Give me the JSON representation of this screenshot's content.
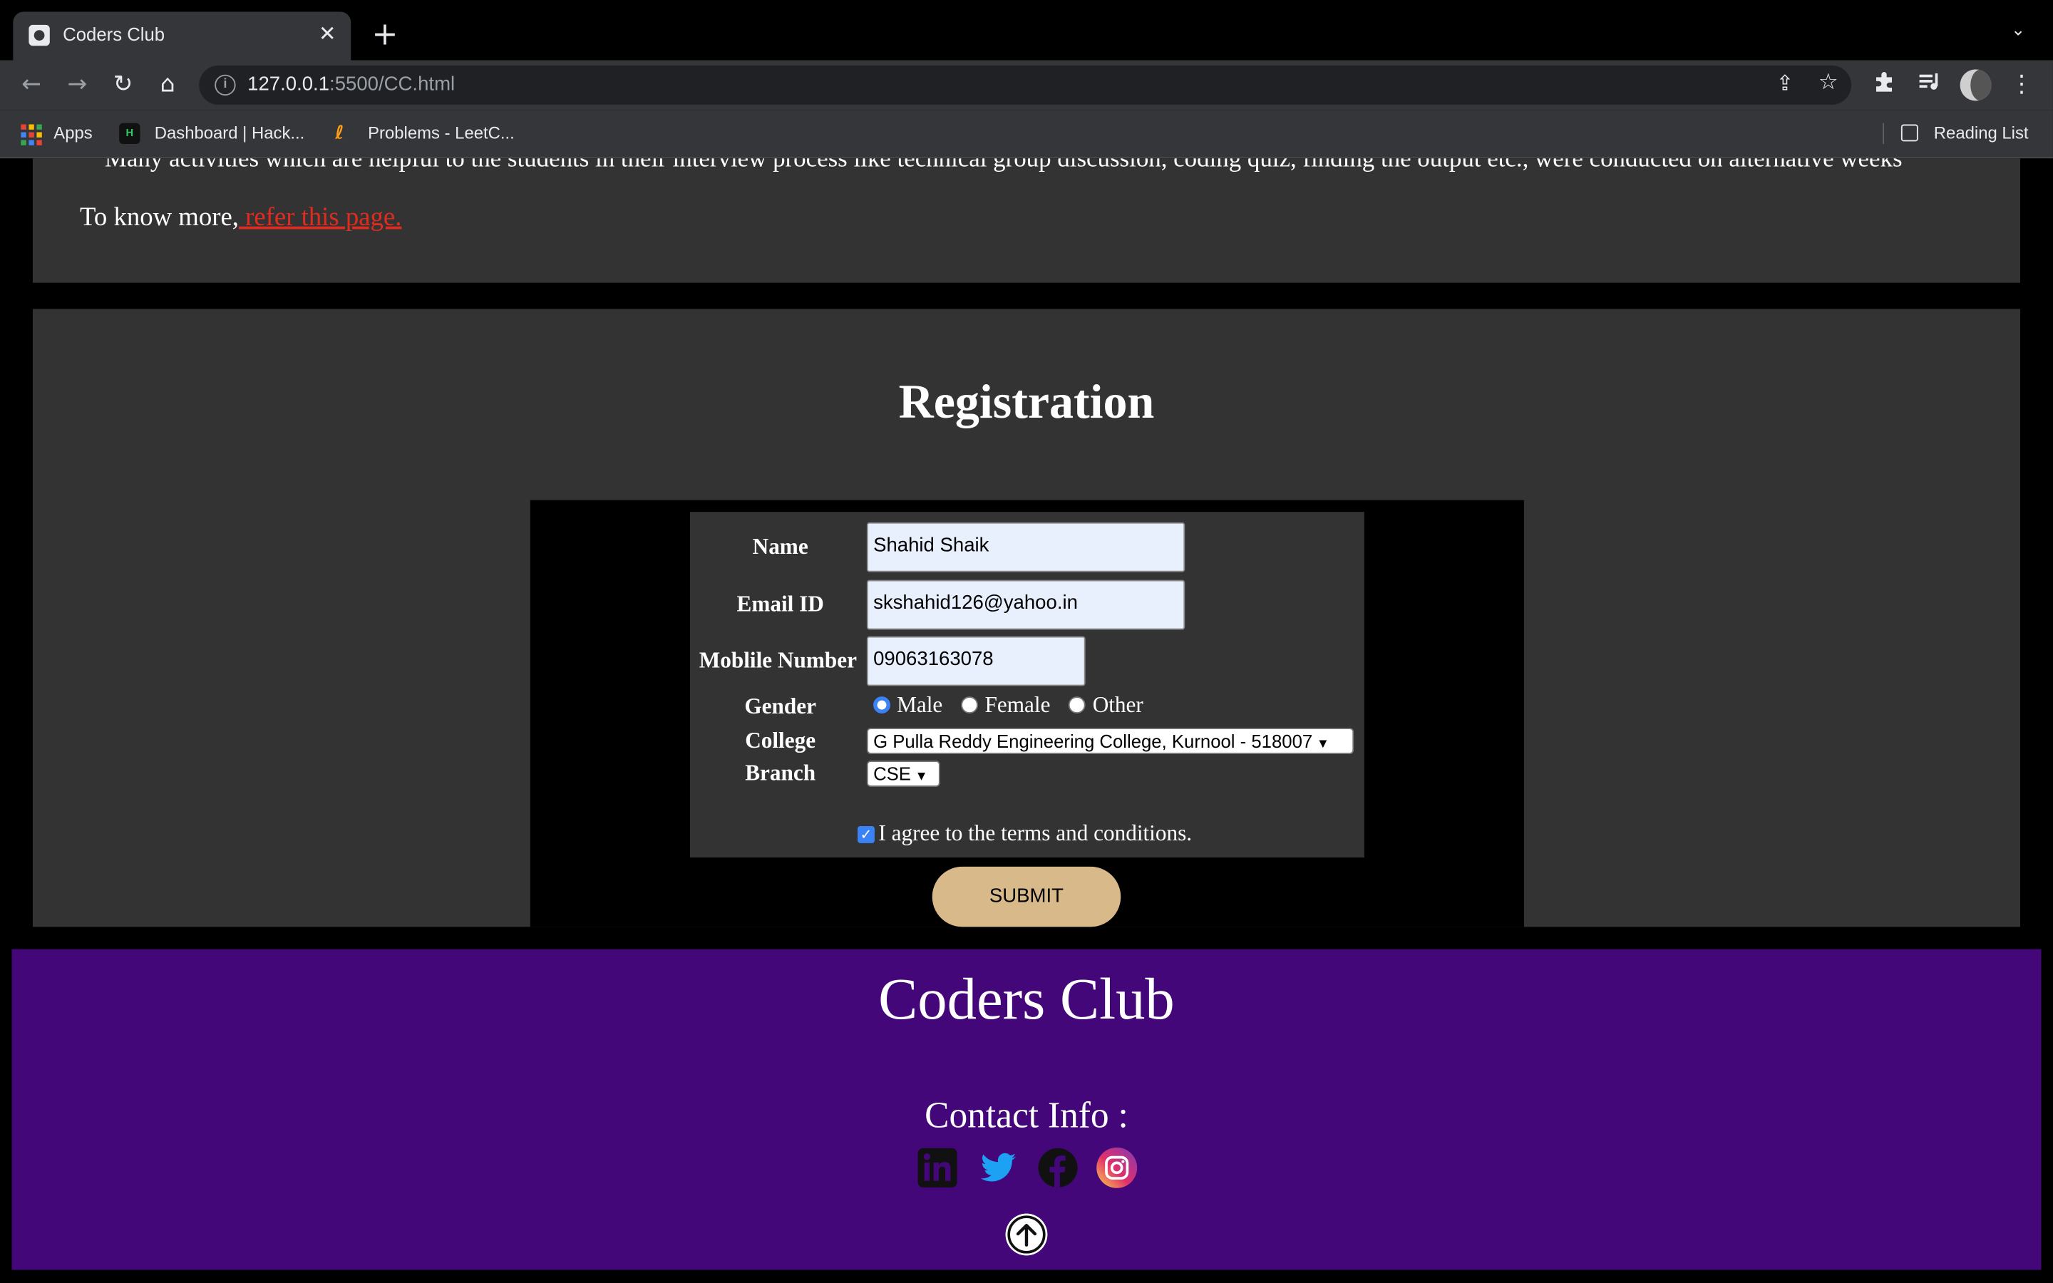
{
  "browser": {
    "tab_title": "Coders Club",
    "url_host": "127.0.0.1",
    "url_rest": ":5500/CC.html",
    "bookmarks": [
      "Apps",
      "Dashboard | Hack...",
      "Problems - LeetC..."
    ],
    "reading_list": "Reading List"
  },
  "about": {
    "cut_text": "Many activities which are helpful to the students in their interview process like technical group discussion, coding quiz, finding the output etc., were conducted on alternative weeks",
    "more_prefix": "To know more,",
    "more_link": " refer this page."
  },
  "registration": {
    "title": "Registration",
    "labels": {
      "name": "Name",
      "email": "Email ID",
      "mobile": "Moblile Number",
      "gender": "Gender",
      "college": "College",
      "branch": "Branch"
    },
    "values": {
      "name": "Shahid Shaik",
      "email": "skshahid126@yahoo.in",
      "mobile": "09063163078",
      "college": "G Pulla Reddy Engineering College, Kurnool - 518007",
      "branch": "CSE"
    },
    "gender_options": [
      "Male",
      "Female",
      "Other"
    ],
    "gender_selected": "Male",
    "agree_text": "I agree to the terms and conditions.",
    "agree_checked": true,
    "submit_label": "SUBMIT"
  },
  "footer": {
    "title": "Coders Club",
    "contact": "Contact Info :",
    "social": [
      "linkedin",
      "twitter",
      "facebook",
      "instagram"
    ]
  },
  "colors": {
    "section_bg": "#333333",
    "footer_bg": "#44077a",
    "link": "#e22b1f",
    "submit_bg": "#d8b98a"
  }
}
